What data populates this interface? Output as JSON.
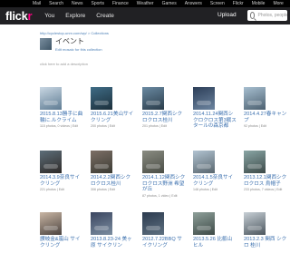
{
  "topbar": [
    "Mail",
    "Search",
    "News",
    "Sports",
    "Finance",
    "Weather",
    "Games",
    "Answers",
    "Screen",
    "Flickr",
    "Mobile",
    "More"
  ],
  "header": {
    "logo_a": "flick",
    "logo_b": "r",
    "nav": [
      "You",
      "Explore",
      "Create"
    ],
    "upload": "Upload",
    "search_placeholder": "Photos, people or groups"
  },
  "breadcrumb": "http://cyclestop-unm.com/wp/ > Collections",
  "collection": {
    "title": "イベント",
    "edit_link": "Edit mosaic for this collection",
    "description": "click here to add a description"
  },
  "tiles": [
    {
      "title": "2015.8.13勝手に曲輪に.ルクライム",
      "meta": "115 photos, 0 videos | Edit",
      "color_a": "#c9d7e3",
      "color_b": "#5f7c93"
    },
    {
      "title": "2015.6.21美山サイクリング",
      "meta": "200 photos | Edit",
      "color_a": "#3f6c86",
      "color_b": "#1c2f3b"
    },
    {
      "title": "2015.2.7関西シクロクロス桂川",
      "meta": "201 photos | Edit",
      "color_a": "#6a8aa2",
      "color_b": "#2a3c4a"
    },
    {
      "title": "2014.11.24関西シクロクロス第3戦スタールの森京都",
      "meta": "",
      "color_a": "#2c3e58",
      "color_b": "#6d85a0"
    },
    {
      "title": "2014.4.27春キャンプ",
      "meta": "92 photos | Edit",
      "color_a": "#a7bfd0",
      "color_b": "#4c6070"
    },
    {
      "title": "2014.3.9奈良サイクリング",
      "meta": "221 photos | Edit",
      "color_a": "#5d6e79",
      "color_b": "#2e2a28"
    },
    {
      "title": "2014.2.2関西シクロクロス桂川",
      "meta": "306 photos | Edit",
      "color_a": "#7c6f66",
      "color_b": "#3b3b33"
    },
    {
      "title": "2014.1.12関西シクロクロス野洲 希望が丘",
      "meta": "87 photos, 1 video | Edit",
      "color_a": "#8a8c82",
      "color_b": "#4a4d45"
    },
    {
      "title": "2014.1.5奈良サイクリング",
      "meta": "148 photos | Edit",
      "color_a": "#b2c4d2",
      "color_b": "#59666e"
    },
    {
      "title": "2013.12.1関西シクロクロス 烏帽子",
      "meta": "233 photos, 7 videos | Edit",
      "color_a": "#8aa6a5",
      "color_b": "#3c4a49"
    },
    {
      "title": "讃岐金&嵐山 サイクリング",
      "meta": "",
      "color_a": "#c9b6a4",
      "color_b": "#4c4440"
    },
    {
      "title": "2013.8.23-24 美ヶ原 サイクリン",
      "meta": "",
      "color_a": "#3b4660",
      "color_b": "#7b8da0"
    },
    {
      "title": "2012.7.22BBQ サイクリング",
      "meta": "",
      "color_a": "#2b3a4e",
      "color_b": "#5e7080"
    },
    {
      "title": "2013.5.26 比叡山 ヒル",
      "meta": "",
      "color_a": "#8fa09a",
      "color_b": "#3d4a47"
    },
    {
      "title": "2013.2.3 関西 シクロ 桂川",
      "meta": "",
      "color_a": "#c8d0d6",
      "color_b": "#4b565e"
    }
  ]
}
